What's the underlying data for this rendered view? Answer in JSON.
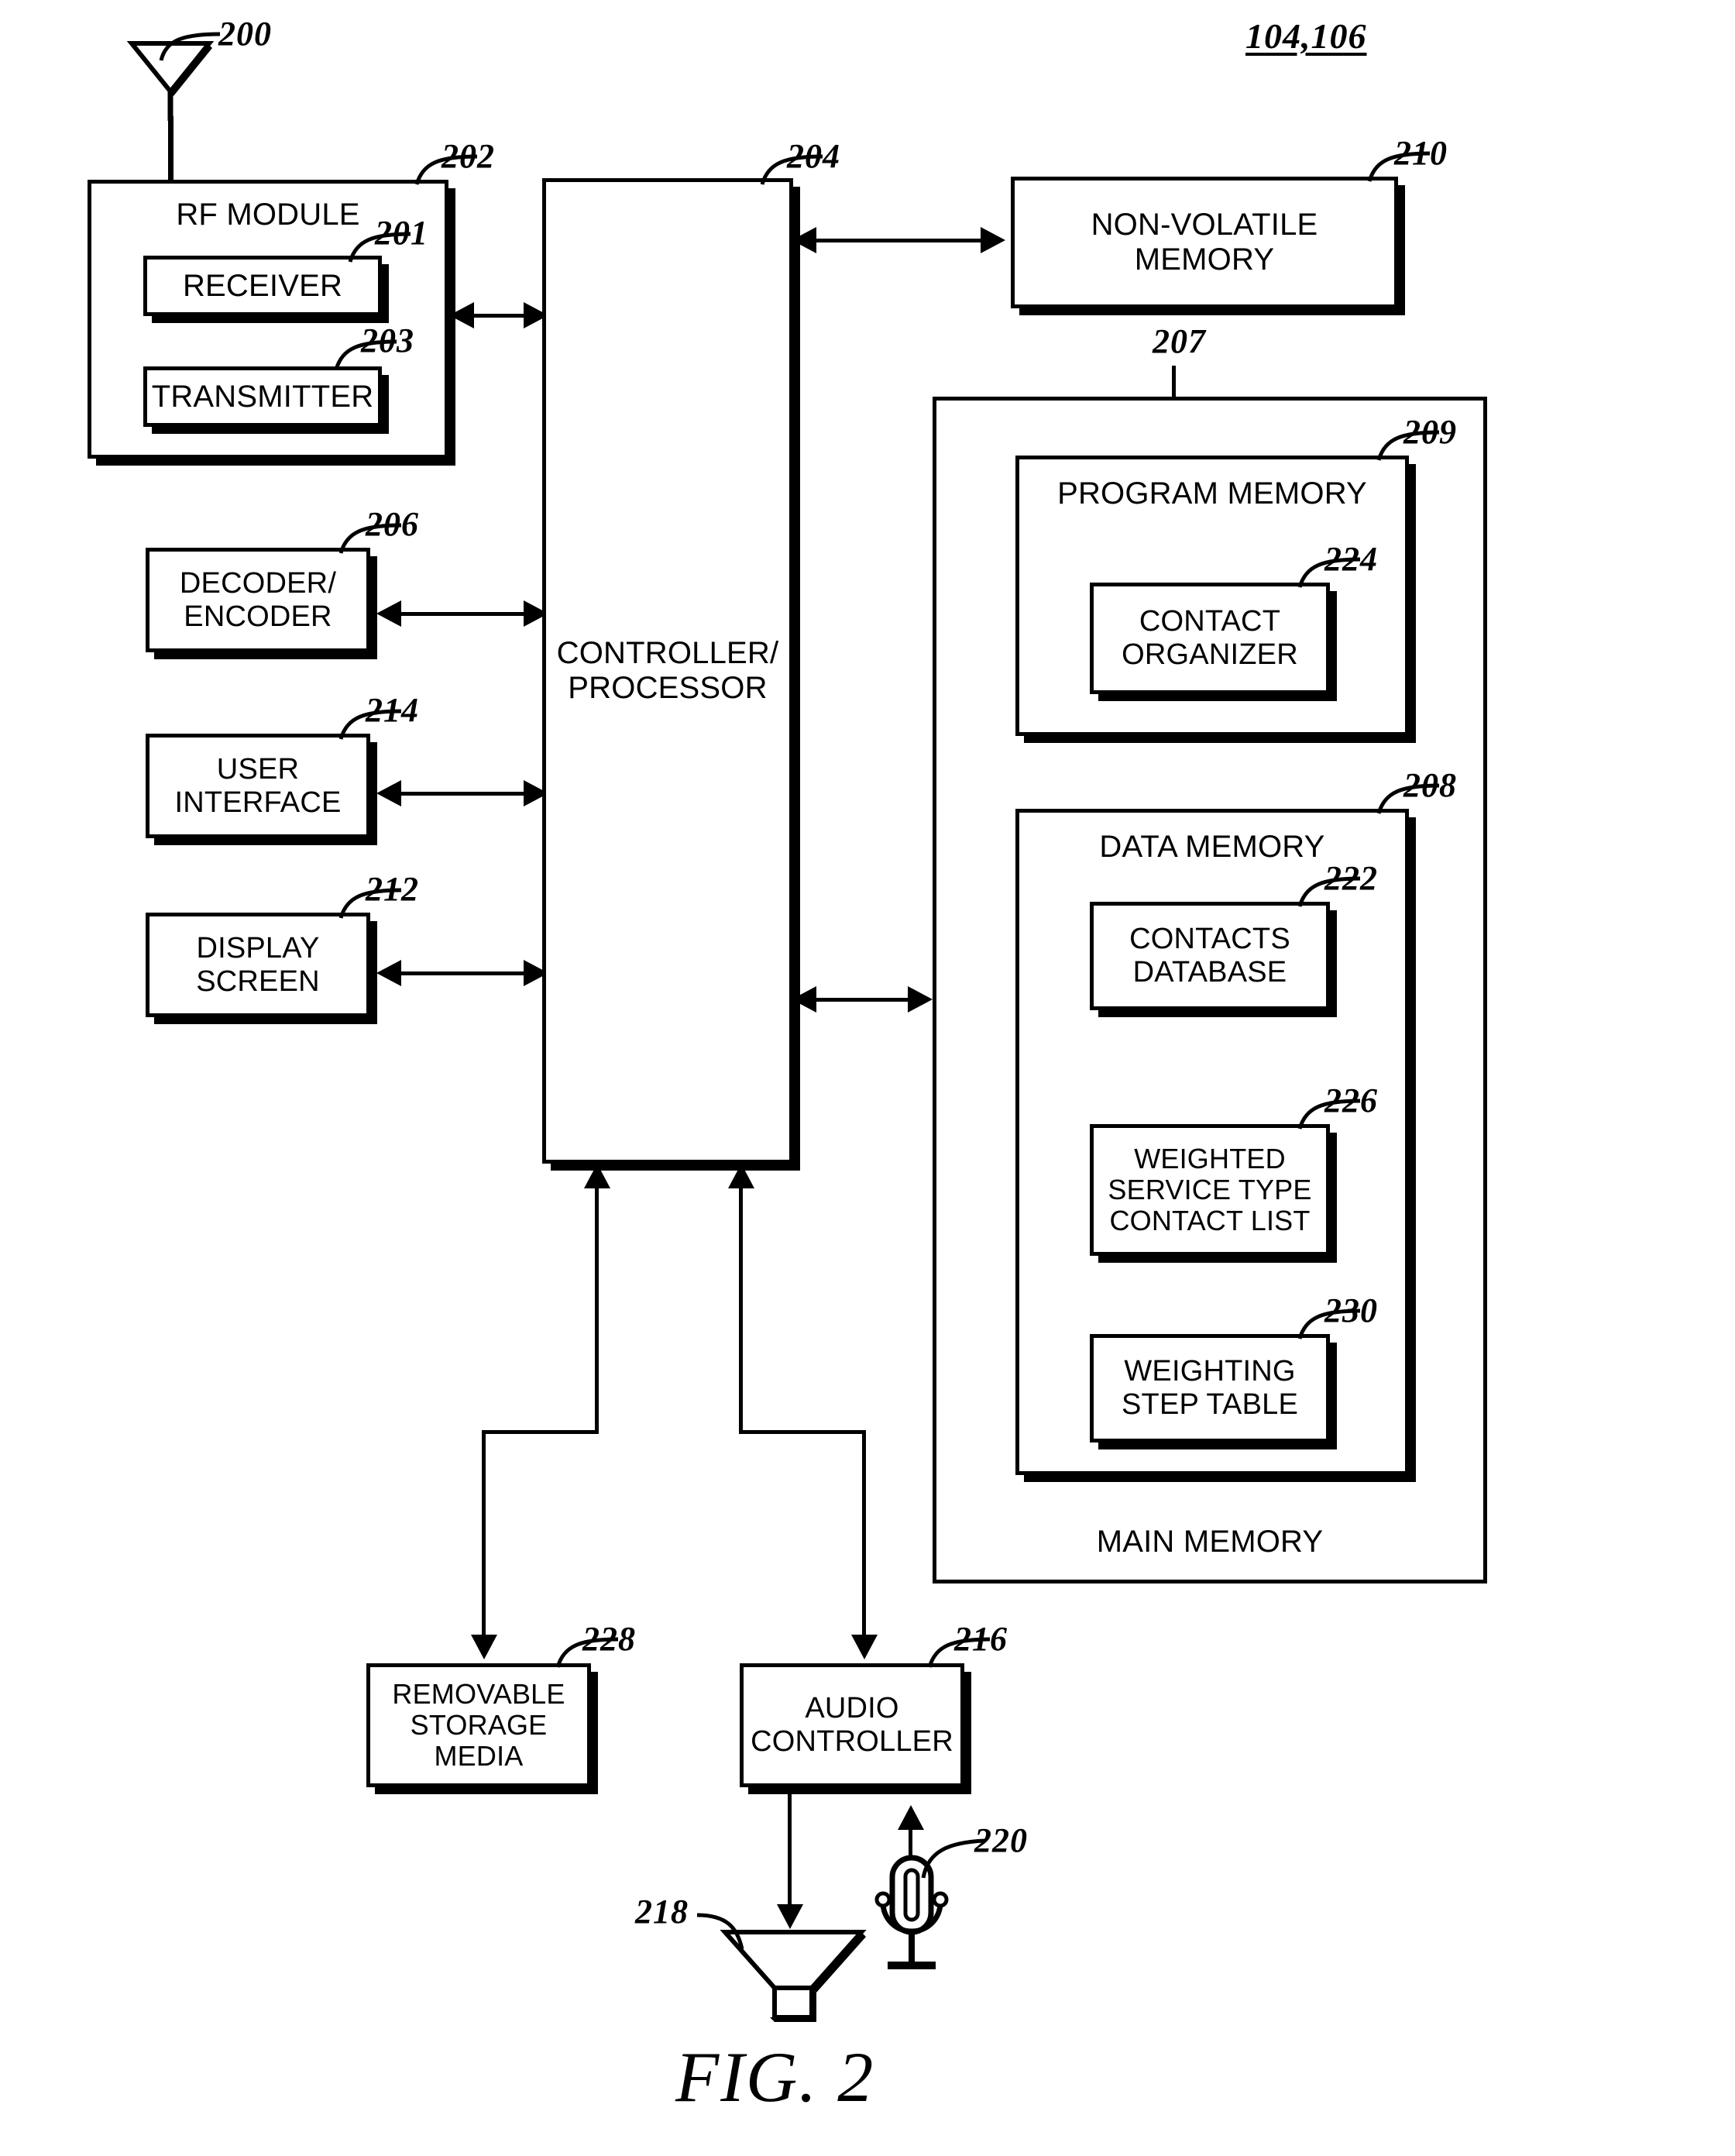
{
  "figure": {
    "caption": "FIG. 2",
    "top_reference": "104,106"
  },
  "blocks": {
    "antenna": {
      "ref": "200",
      "label": ""
    },
    "rf_module": {
      "ref": "202",
      "label": "RF MODULE"
    },
    "receiver": {
      "ref": "201",
      "label": "RECEIVER"
    },
    "transmitter": {
      "ref": "203",
      "label": "TRANSMITTER"
    },
    "decoder_encoder": {
      "ref": "206",
      "label_line1": "DECODER/",
      "label_line2": "ENCODER"
    },
    "user_interface": {
      "ref": "214",
      "label_line1": "USER",
      "label_line2": "INTERFACE"
    },
    "display_screen": {
      "ref": "212",
      "label_line1": "DISPLAY",
      "label_line2": "SCREEN"
    },
    "controller": {
      "ref": "204",
      "label_line1": "CONTROLLER/",
      "label_line2": "PROCESSOR"
    },
    "non_volatile_memory": {
      "ref": "210",
      "label_line1": "NON-VOLATILE",
      "label_line2": "MEMORY"
    },
    "main_memory": {
      "ref": "207",
      "label": "MAIN MEMORY"
    },
    "program_memory": {
      "ref": "209",
      "label": "PROGRAM MEMORY"
    },
    "contact_organizer": {
      "ref": "224",
      "label_line1": "CONTACT",
      "label_line2": "ORGANIZER"
    },
    "data_memory": {
      "ref": "208",
      "label": "DATA MEMORY"
    },
    "contacts_database": {
      "ref": "222",
      "label_line1": "CONTACTS",
      "label_line2": "DATABASE"
    },
    "weighted_list": {
      "ref": "226",
      "label_line1": "WEIGHTED",
      "label_line2": "SERVICE TYPE",
      "label_line3": "CONTACT LIST"
    },
    "weighting_step_table": {
      "ref": "230",
      "label_line1": "WEIGHTING",
      "label_line2": "STEP TABLE"
    },
    "removable_storage": {
      "ref": "228",
      "label_line1": "REMOVABLE",
      "label_line2": "STORAGE",
      "label_line3": "MEDIA"
    },
    "audio_controller": {
      "ref": "216",
      "label_line1": "AUDIO",
      "label_line2": "CONTROLLER"
    },
    "speaker": {
      "ref": "218",
      "label": ""
    },
    "microphone": {
      "ref": "220",
      "label": ""
    }
  },
  "colors": {
    "ink": "#000000",
    "paper": "#ffffff"
  }
}
